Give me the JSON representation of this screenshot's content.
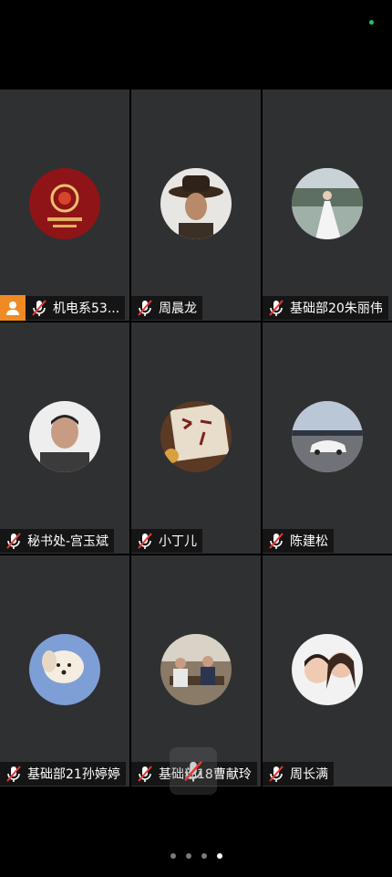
{
  "participants": [
    {
      "name": "机电系53...",
      "icon": "red-lion-avatar",
      "muted": true,
      "host": true
    },
    {
      "name": "周晨龙",
      "icon": "cowboy-avatar",
      "muted": true
    },
    {
      "name": "基础部20朱丽伟",
      "icon": "bride-avatar",
      "muted": true
    },
    {
      "name": "秘书处-宫玉斌",
      "icon": "man-selfie-avatar",
      "muted": true
    },
    {
      "name": "小丁儿",
      "icon": "calligraphy-avatar",
      "muted": true
    },
    {
      "name": "陈建松",
      "icon": "white-car-avatar",
      "muted": true
    },
    {
      "name": "基础部21孙婷婷",
      "icon": "white-dog-avatar",
      "muted": true
    },
    {
      "name": "基础部18曹献玲",
      "icon": "office-avatar",
      "muted": true
    },
    {
      "name": "周长满",
      "icon": "mother-child-avatar",
      "muted": true
    }
  ],
  "pager": {
    "pages": 4,
    "current": 4
  },
  "colors": {
    "tile": "#2f3032",
    "host_badge": "#f08a24",
    "mic_strike": "#e53935"
  }
}
